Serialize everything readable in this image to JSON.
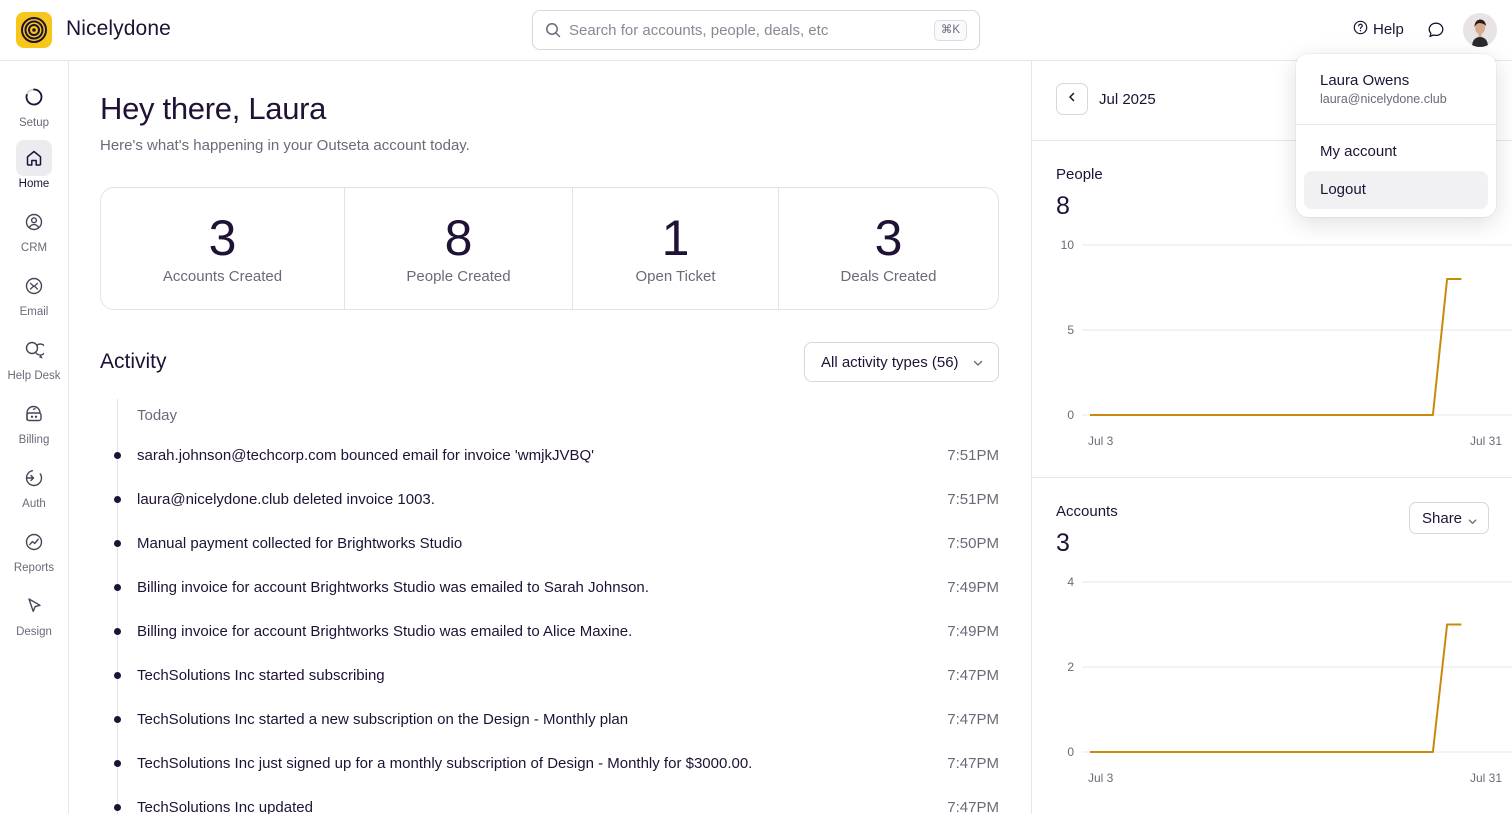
{
  "app": {
    "brand": "Nicelydone"
  },
  "search": {
    "placeholder": "Search for accounts, people, deals, etc",
    "shortcut": "⌘K",
    "value": ""
  },
  "header": {
    "help_label": "Help"
  },
  "nav": {
    "items": [
      {
        "label": "Setup",
        "icon": "setup-progress-icon"
      },
      {
        "label": "Home",
        "icon": "home-icon",
        "active": true
      },
      {
        "label": "CRM",
        "icon": "crm-person-icon"
      },
      {
        "label": "Email",
        "icon": "email-icon"
      },
      {
        "label": "Help Desk",
        "icon": "help-desk-chat-icon"
      },
      {
        "label": "Billing",
        "icon": "billing-icon"
      },
      {
        "label": "Auth",
        "icon": "auth-icon"
      },
      {
        "label": "Reports",
        "icon": "reports-icon"
      },
      {
        "label": "Design",
        "icon": "design-cursor-icon"
      }
    ]
  },
  "main": {
    "greeting": "Hey there, Laura",
    "subtitle": "Here's what's happening in your Outseta account today.",
    "stats": [
      {
        "value": "3",
        "label": "Accounts Created"
      },
      {
        "value": "8",
        "label": "People Created"
      },
      {
        "value": "1",
        "label": "Open Ticket"
      },
      {
        "value": "3",
        "label": "Deals Created"
      }
    ],
    "activity": {
      "title": "Activity",
      "filter_label": "All activity types (56)",
      "group_label": "Today",
      "items": [
        {
          "text": "sarah.johnson@techcorp.com bounced email for invoice 'wmjkJVBQ'",
          "time": "7:51PM"
        },
        {
          "text": "laura@nicelydone.club deleted invoice 1003.",
          "time": "7:51PM"
        },
        {
          "text": "Manual payment collected for Brightworks Studio",
          "time": "7:50PM"
        },
        {
          "text": "Billing invoice for account Brightworks Studio was emailed to Sarah Johnson.",
          "time": "7:49PM"
        },
        {
          "text": "Billing invoice for account Brightworks Studio was emailed to Alice Maxine.",
          "time": "7:49PM"
        },
        {
          "text": "TechSolutions Inc started subscribing",
          "time": "7:47PM"
        },
        {
          "text": "TechSolutions Inc started a new subscription on the Design - Monthly plan",
          "time": "7:47PM"
        },
        {
          "text": "TechSolutions Inc just signed up for a monthly subscription of Design - Monthly for $3000.00.",
          "time": "7:47PM"
        },
        {
          "text": "TechSolutions Inc updated",
          "time": "7:47PM"
        }
      ]
    }
  },
  "right": {
    "month_label": "Jul 2025",
    "people": {
      "title": "People",
      "value": "8"
    },
    "accounts": {
      "title": "Accounts",
      "value": "3",
      "share_label": "Share"
    }
  },
  "dropdown": {
    "name": "Laura Owens",
    "email": "laura@nicelydone.club",
    "items": [
      {
        "label": "My account"
      },
      {
        "label": "Logout",
        "highlighted": true
      }
    ]
  },
  "colors": {
    "accent": "#f6c61a",
    "line": "#c98a0c",
    "text": "#1f1235",
    "muted": "#6e6878"
  },
  "chart_data": [
    {
      "type": "line",
      "title": "People",
      "x_tick_labels": [
        "Jul 3",
        "Jul 31"
      ],
      "x": [
        "Jul 3",
        "Jul 27",
        "Jul 28",
        "Jul 29"
      ],
      "values": [
        0,
        0,
        8,
        8
      ],
      "yticks": [
        0,
        5,
        10
      ],
      "ylim": [
        0,
        10
      ],
      "grid": true
    },
    {
      "type": "line",
      "title": "Accounts",
      "x_tick_labels": [
        "Jul 3",
        "Jul 31"
      ],
      "x": [
        "Jul 3",
        "Jul 27",
        "Jul 28",
        "Jul 29"
      ],
      "values": [
        0,
        0,
        3,
        3
      ],
      "yticks": [
        0,
        2,
        4
      ],
      "ylim": [
        0,
        4
      ],
      "grid": true
    }
  ]
}
